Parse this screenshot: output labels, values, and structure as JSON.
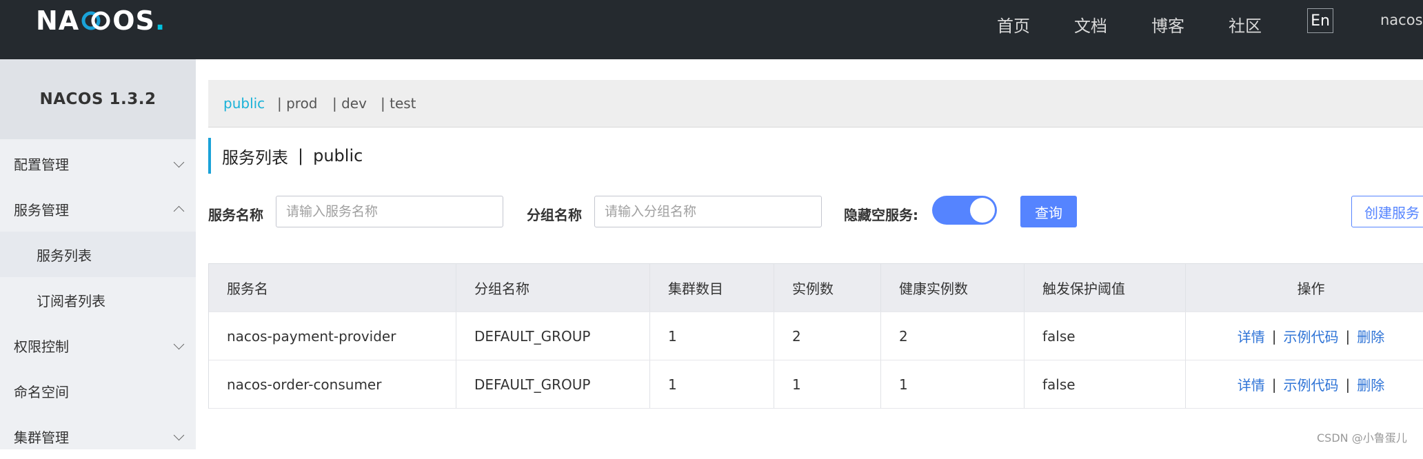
{
  "header": {
    "logo_text_left": "NA",
    "logo_text_right": "OS",
    "logo_dot": ".",
    "nav": [
      "首页",
      "文档",
      "博客",
      "社区"
    ],
    "lang_button": "En",
    "user": "nacos"
  },
  "sidebar": {
    "version": "NACOS 1.3.2",
    "items": [
      {
        "label": "配置管理",
        "chevron": "down"
      },
      {
        "label": "服务管理",
        "chevron": "up"
      },
      {
        "label": "服务列表",
        "sub": true,
        "active": true
      },
      {
        "label": "订阅者列表",
        "sub": true
      },
      {
        "label": "权限控制",
        "chevron": "down"
      },
      {
        "label": "命名空间"
      },
      {
        "label": "集群管理",
        "chevron": "down"
      }
    ]
  },
  "namespaces": [
    {
      "label": "public",
      "active": true
    },
    {
      "label": "| prod"
    },
    {
      "label": "| dev"
    },
    {
      "label": "| test"
    }
  ],
  "page": {
    "title": "服务列表",
    "separator": "|",
    "namespace": "public"
  },
  "filters": {
    "service_name_label": "服务名称",
    "service_name_placeholder": "请输入服务名称",
    "group_name_label": "分组名称",
    "group_name_placeholder": "请输入分组名称",
    "hide_empty_label": "隐藏空服务:",
    "hide_empty_on": true,
    "query_button": "查询",
    "create_button": "创建服务"
  },
  "table": {
    "columns": [
      "服务名",
      "分组名称",
      "集群数目",
      "实例数",
      "健康实例数",
      "触发保护阈值",
      "操作"
    ],
    "rows": [
      {
        "name": "nacos-payment-provider",
        "group": "DEFAULT_GROUP",
        "clusters": "1",
        "instances": "2",
        "healthy": "2",
        "threshold": "false"
      },
      {
        "name": "nacos-order-consumer",
        "group": "DEFAULT_GROUP",
        "clusters": "1",
        "instances": "1",
        "healthy": "1",
        "threshold": "false"
      }
    ],
    "actions": {
      "detail": "详情",
      "sample": "示例代码",
      "delete": "删除",
      "sep": "|"
    }
  },
  "watermark": "CSDN @小鲁蛋儿",
  "colors": {
    "topbar": "#252a2f",
    "accent": "#5584ff",
    "namespace_active": "#1ab2d8",
    "link": "#2e73d6"
  }
}
